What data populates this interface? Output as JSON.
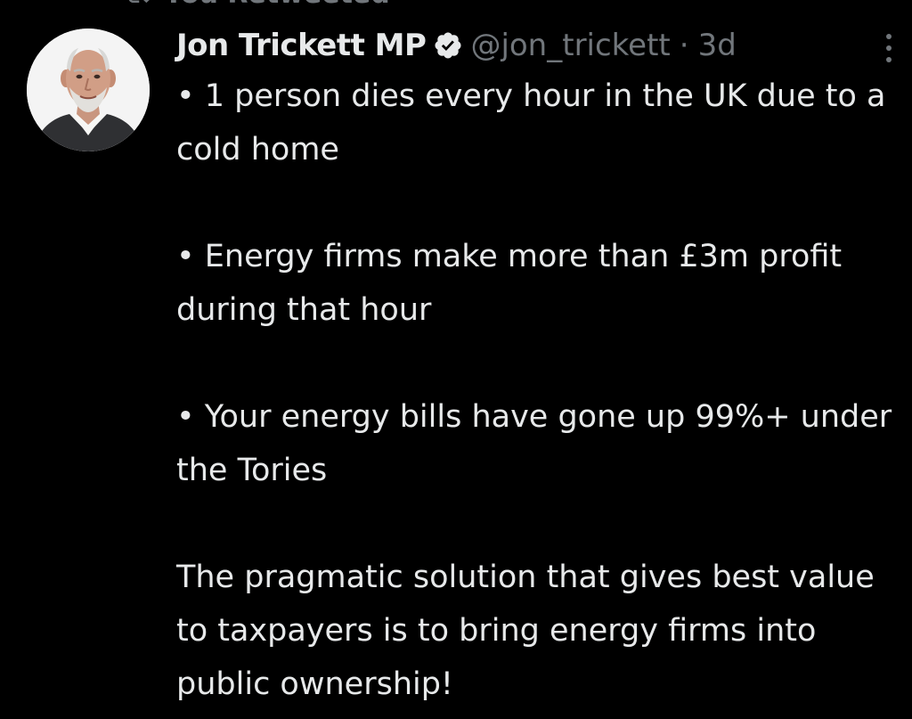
{
  "top_context": {
    "label": "You Retweeted"
  },
  "tweet": {
    "author": {
      "display_name": "Jon Trickett MP",
      "handle": "@jon_trickett",
      "verified": true
    },
    "separator": "·",
    "timestamp": "3d",
    "paragraphs": [
      "• 1 person dies every hour in the UK due to a cold home",
      "• Energy firms make more than £3m profit during that hour",
      "• Your energy bills have gone up 99%+ under the Tories",
      "The pragmatic solution that gives best value to taxpayers is to bring energy firms into public ownership!"
    ]
  },
  "icons": {
    "retweet": "retweet-icon",
    "verified": "verified-badge-icon",
    "more": "more-options-icon"
  },
  "colors": {
    "background": "#000000",
    "primary_text": "#e7e9ea",
    "secondary_text": "#71767b"
  }
}
